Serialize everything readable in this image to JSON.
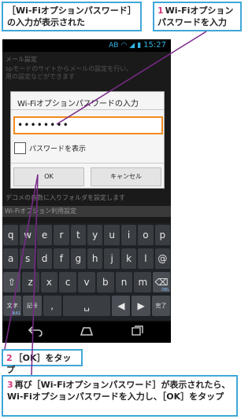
{
  "annotations": {
    "top_left": "［Wi-Fiオプションパスワード］の入力が表示された",
    "step1": {
      "num": "1",
      "text": "Wi-Fiオプションパスワードを入力"
    },
    "step2": {
      "num": "2",
      "text": "［OK］をタップ"
    },
    "step3": {
      "num": "3",
      "text": "再び［Wi-Fiオプションパスワード］が表示されたら、Wi-Fiオプションパスワードを入力し、［OK］をタップ"
    }
  },
  "status_bar": {
    "carrier": "AB",
    "time": "15:27"
  },
  "background": {
    "header": "メール設定",
    "desc_line1": "spモードのサイトからメールの設定を行い、",
    "desc_line2": "用の設定などができます",
    "folder_text": "デコメの音数に入りフォルダを設定します",
    "section_header": "Wi-Fiオプション利用設定",
    "sub_text": "Wi-Fiオプション利用設定"
  },
  "dialog": {
    "title": "Wi-Fiオプションパスワードの入力",
    "password_value": "••••••••",
    "show_password_label": "パスワードを表示",
    "ok_label": "OK",
    "cancel_label": "キャンセル"
  },
  "keyboard": {
    "row1": [
      "q",
      "w",
      "e",
      "r",
      "t",
      "y",
      "u",
      "i",
      "o",
      "p"
    ],
    "row2": [
      "a",
      "s",
      "d",
      "f",
      "g",
      "h",
      "j",
      "k",
      "l",
      "@"
    ],
    "row3": [
      "⇧",
      "z",
      "x",
      "c",
      "v",
      "b",
      "n",
      "m",
      "⌫"
    ],
    "row3_del_sub": "DEL",
    "row4": {
      "lang": "文字",
      "lang_sub": "あA1",
      "symbols": "記号",
      "comma": ",",
      "space": "␣",
      "left": "◀",
      "right": "▶",
      "done": "完了"
    }
  },
  "nav": {
    "back_icon": "back-arrow-icon",
    "home_icon": "home-icon",
    "recent_icon": "recent-apps-icon"
  },
  "colors": {
    "callout_border": "#3fa7d8",
    "step_number": "#d4377d",
    "input_focus": "#f28b1e",
    "status_accent": "#33b5e5"
  }
}
